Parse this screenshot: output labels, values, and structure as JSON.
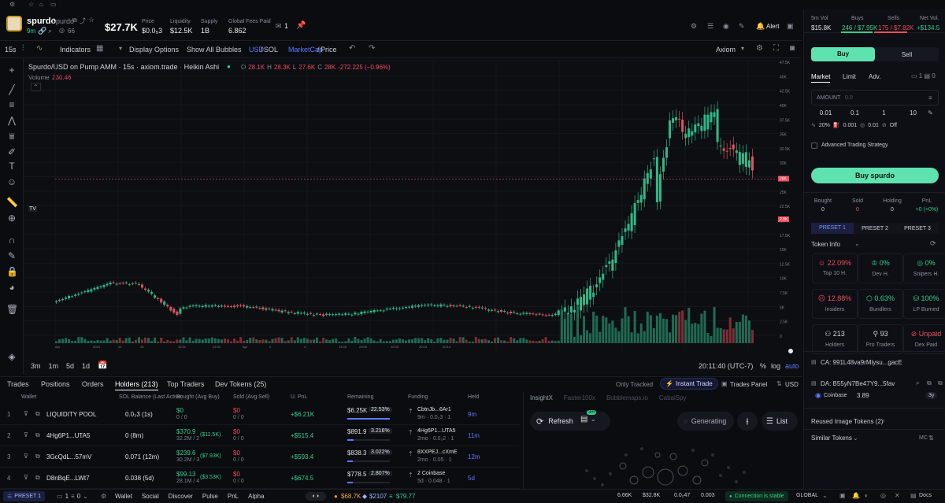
{
  "token": {
    "symbol": "spurdo",
    "name": "Spurdo",
    "age": "9m",
    "holders_icon_count": "66",
    "marketcap": "$27.7K",
    "price_label": "Price",
    "price": "$0.0₅3",
    "liquidity_label": "Liquidity",
    "liquidity": "$12.5K",
    "supply_label": "Supply",
    "supply": "1B",
    "fees_label": "Global Fees Paid",
    "fees": "6.862",
    "watchers": "1",
    "alert": "Alert"
  },
  "toolbar": {
    "interval": "15s",
    "indicators": "Indicators",
    "display": "Display Options",
    "bubbles": "Show All Bubbles",
    "usd": "USD",
    "sol": "SOL",
    "mcap": "MarketCap",
    "price": "Price",
    "provider": "Axiom"
  },
  "chart": {
    "title": "Spurdo/USD on Pump AMM · 15s · axiom.trade · Heikin Ashi",
    "o": "28.1K",
    "h": "28.3K",
    "l": "27.6K",
    "c": "28K",
    "chg": "-272.225 (−0.96%)",
    "volume_label": "Volume",
    "volume": "230.46",
    "yticks": [
      "47.5K",
      "45K",
      "42.5K",
      "40K",
      "37.5K",
      "35K",
      "32.5K",
      "30K",
      "28K",
      "25K",
      "22.5K",
      "20K",
      "17.5K",
      "15K",
      "12.5K",
      "10K",
      "7.5K",
      "5K",
      "2.5K",
      "0"
    ],
    "price_tag": "28K",
    "cross_tag": "2.8K",
    "xticks": [
      "Apr",
      "2024",
      "14",
      "28",
      "12:01",
      "23:30",
      "Apr",
      "2",
      "4",
      "13:05",
      "20:00",
      "12:00",
      "20:13",
      "20:14"
    ],
    "ranges": [
      "3m",
      "1m",
      "5d",
      "1d"
    ],
    "time": "20:11:40 (UTC-7)",
    "pct": "%",
    "log": "log",
    "auto": "auto"
  },
  "tabs": {
    "trades": "Trades",
    "positions": "Positions",
    "orders": "Orders",
    "holders": "Holders (213)",
    "top": "Top Traders",
    "dev": "Dev Tokens (25)",
    "only_tracked": "Only Tracked",
    "instant": "Instant Trade",
    "panel": "Trades Panel",
    "ccy": "USD"
  },
  "table": {
    "headers": [
      "Wallet",
      "SOL Balance (Last Active)",
      "Bought (Avg Buy)",
      "Sold (Avg Sell)",
      "U. PnL",
      "Remaining",
      "Funding",
      "Held"
    ],
    "rows": [
      {
        "n": "1",
        "wallet": "LIQUIDITY POOL",
        "bal": "0.0₃3 (1s)",
        "bought": "$0",
        "bsub": "0 / 0",
        "sold": "$0",
        "ssub": "0 / 0",
        "pnl": "+$6.21K",
        "rem": "$6.25K",
        "pct": "22.53%",
        "fund": "CbtnJb...6Ar1",
        "fsub": "9m · 0.0₂3 · 1",
        "held": "9m"
      },
      {
        "n": "2",
        "wallet": "4Hg6P1...UTA5",
        "bal": "0 (8m)",
        "bought": "$370.9",
        "bsub": "32.2M / 2",
        "bx": "($11.5K)",
        "sold": "$0",
        "ssub": "0 / 0",
        "pnl": "+$515.4",
        "rem": "$891.9",
        "pct": "3.216%",
        "fund": "4Hg6P1...UTA5",
        "fsub": "2mo · 0.0₂2 · 1",
        "held": "11m"
      },
      {
        "n": "3",
        "wallet": "3GcQdL...57mV",
        "bal": "0.071 (12m)",
        "bought": "$239.6",
        "bsub": "30.2M / 3",
        "bx": "($7.93K)",
        "sold": "$0",
        "ssub": "0 / 0",
        "pnl": "+$593.4",
        "rem": "$838.3",
        "pct": "3.022%",
        "fund": "8XXPEJ...cXmE",
        "fsub": "2mo · 0.05 · 1",
        "held": "12m"
      },
      {
        "n": "4",
        "wallet": "D8nBqE...LWt7",
        "bal": "0.038 (5d)",
        "bought": "$99.13",
        "bsub": "28.1M / 4",
        "bx": "($3.53K)",
        "sold": "$0",
        "ssub": "0 / 0",
        "pnl": "+$674.5",
        "rem": "$778.5",
        "pct": "2.807%",
        "fund": "2 Coinbase",
        "fsub": "5d · 0.048 · 1",
        "held": "5d"
      }
    ]
  },
  "insight": {
    "tabs": [
      "InsightX",
      "Faster100x",
      "Bubblemaps.io",
      "CabalSpy"
    ],
    "refresh": "Refresh",
    "badge": "3m",
    "generating": "Generating",
    "list": "List"
  },
  "right": {
    "vol_label": "5m Vol",
    "vol": "$15.8K",
    "buys_label": "Buys",
    "buys": "246 / $7.95K",
    "sells_label": "Sells",
    "sells": "175 / $7.82K",
    "net_label": "Net Vol.",
    "net": "+$134.5",
    "buy": "Buy",
    "sell": "Sell",
    "market": "Market",
    "limit": "Limit",
    "adv": "Adv.",
    "amount": "AMOUNT",
    "amount_ph": "0.0",
    "presets": [
      "0.01",
      "0.1",
      "1",
      "10"
    ],
    "slip": "20%",
    "prio": "0.001",
    "bribe": "0.01",
    "mev": "Off",
    "adv_strategy": "Advanced Trading Strategy",
    "buy_btn": "Buy spurdo",
    "stats": [
      {
        "l": "Bought",
        "v": "0"
      },
      {
        "l": "Sold",
        "v": "0"
      },
      {
        "l": "Holding",
        "v": "0"
      },
      {
        "l": "PnL",
        "v": "+0 (+0%)"
      }
    ],
    "preset_tabs": [
      "PRESET 1",
      "PRESET 2",
      "PRESET 3"
    ],
    "token_info": "Token Info",
    "info": [
      {
        "v": "22.09%",
        "l": "Top 10 H."
      },
      {
        "v": "0%",
        "l": "Dev H."
      },
      {
        "v": "0%",
        "l": "Snipers H."
      },
      {
        "v": "12.88%",
        "l": "Insiders"
      },
      {
        "v": "0.63%",
        "l": "Bundlers"
      },
      {
        "v": "100%",
        "l": "LP Burned"
      },
      {
        "v": "213",
        "l": "Holders"
      },
      {
        "v": "93",
        "l": "Pro Traders"
      },
      {
        "v": "Unpaid",
        "l": "Dex Paid"
      }
    ],
    "ca": "CA: 991L48va9rMiysu...gacE",
    "da": "DA: B55yN7Be47Y9...5fav",
    "coinbase": "Coinbase",
    "cb_val": "3.89",
    "cb_age": "3y",
    "reused": "Reused Image Tokens (2)",
    "similar": "Similar Tokens",
    "mc": "MC"
  },
  "footer": {
    "preset": "PRESET 1",
    "count": "1",
    "zero": "0",
    "wallet": "Wallet",
    "social": "Social",
    "discover": "Discover",
    "pulse": "Pulse",
    "pnl": "PnL",
    "alpha": "Alpha",
    "btc": "$68.7K",
    "eth": "$2107",
    "sol": "$79.77",
    "s1": "6.66K",
    "s2": "$32.8K",
    "s3": "0.0₂47",
    "s4": "0.003",
    "conn": "Connection is stable",
    "global": "GLOBAL",
    "docs": "Docs"
  }
}
